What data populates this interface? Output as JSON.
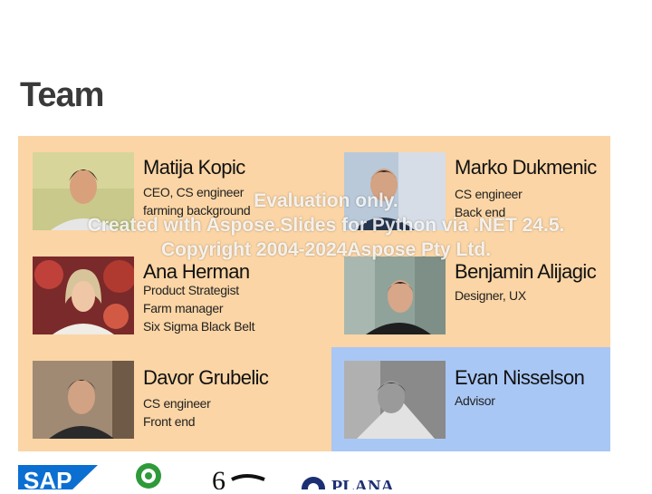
{
  "slide": {
    "title": "Team"
  },
  "members": [
    {
      "name": "Matija Kopic",
      "roles": [
        "CEO, CS engineer",
        "farming background"
      ]
    },
    {
      "name": "Marko Dukmenic",
      "roles": [
        "CS engineer",
        "Back end"
      ]
    },
    {
      "name": "Ana Herman",
      "roles": [
        "Product Strategist",
        "Farm manager",
        "Six Sigma Black Belt"
      ]
    },
    {
      "name": "Benjamin Alijagic",
      "roles": [
        "Designer, UX"
      ]
    },
    {
      "name": "Davor Grubelic",
      "roles": [
        "CS engineer",
        "Front end"
      ]
    },
    {
      "name": "Evan Nisselson",
      "roles": [
        "Advisor"
      ]
    }
  ],
  "watermark": {
    "line1": "Evaluation only.",
    "line2": "Created with Aspose.Slides for Python via .NET 24.5.",
    "line3": "Copyright 2004-2024Aspose Pty Ltd."
  },
  "logos": {
    "sap": "SAP",
    "sixth": "6",
    "plana": "PLANA"
  },
  "colors": {
    "team_panel": "#fbd5a5",
    "advisor_panel": "#a9c7f5",
    "sap_blue": "#0a6fd1",
    "plana_navy": "#1c2f73"
  },
  "icons": [
    "person-photo",
    "sap-logo",
    "green-leaf-logo",
    "six-logo",
    "plana-logo"
  ]
}
